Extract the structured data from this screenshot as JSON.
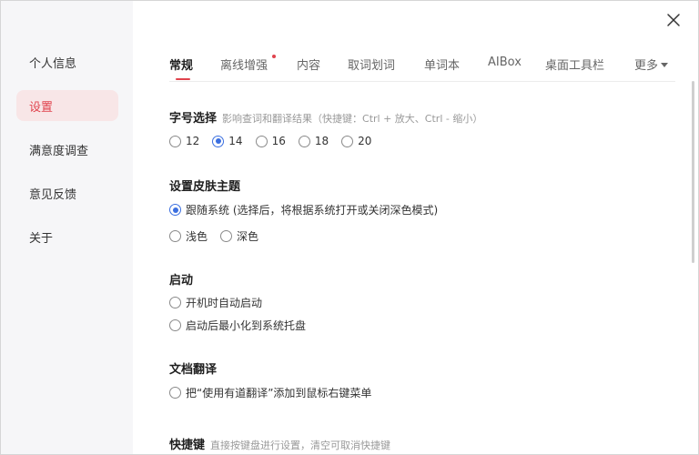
{
  "sidebar": {
    "items": [
      {
        "label": "个人信息"
      },
      {
        "label": "设置"
      },
      {
        "label": "满意度调查"
      },
      {
        "label": "意见反馈"
      },
      {
        "label": "关于"
      }
    ]
  },
  "tabs": [
    {
      "label": "常规"
    },
    {
      "label": "离线增强"
    },
    {
      "label": "内容"
    },
    {
      "label": "取词划词"
    },
    {
      "label": "单词本"
    },
    {
      "label": "AIBox"
    },
    {
      "label": "桌面工具栏"
    },
    {
      "label": "更多"
    }
  ],
  "font_size": {
    "title": "字号选择",
    "hint": "影响查词和翻译结果（快捷键：Ctrl + 放大、Ctrl - 缩小）",
    "options": [
      "12",
      "14",
      "16",
      "18",
      "20"
    ],
    "selected": "14"
  },
  "theme": {
    "title": "设置皮肤主题",
    "follow_system": "跟随系统 (选择后，将根据系统打开或关闭深色模式)",
    "light": "浅色",
    "dark": "深色",
    "selected": "follow_system"
  },
  "startup": {
    "title": "启动",
    "auto_start": "开机时自动启动",
    "minimize_tray": "启动后最小化到系统托盘"
  },
  "doc_translate": {
    "title": "文档翻译",
    "context_menu": "把“使用有道翻译”添加到鼠标右键菜单"
  },
  "shortcuts": {
    "title": "快捷键",
    "hint": "直接按键盘进行设置，清空可取消快捷键"
  },
  "colors": {
    "accent": "#e0434d",
    "radio_checked": "#3b6fe0",
    "sidebar_bg": "#f6f6f8"
  }
}
